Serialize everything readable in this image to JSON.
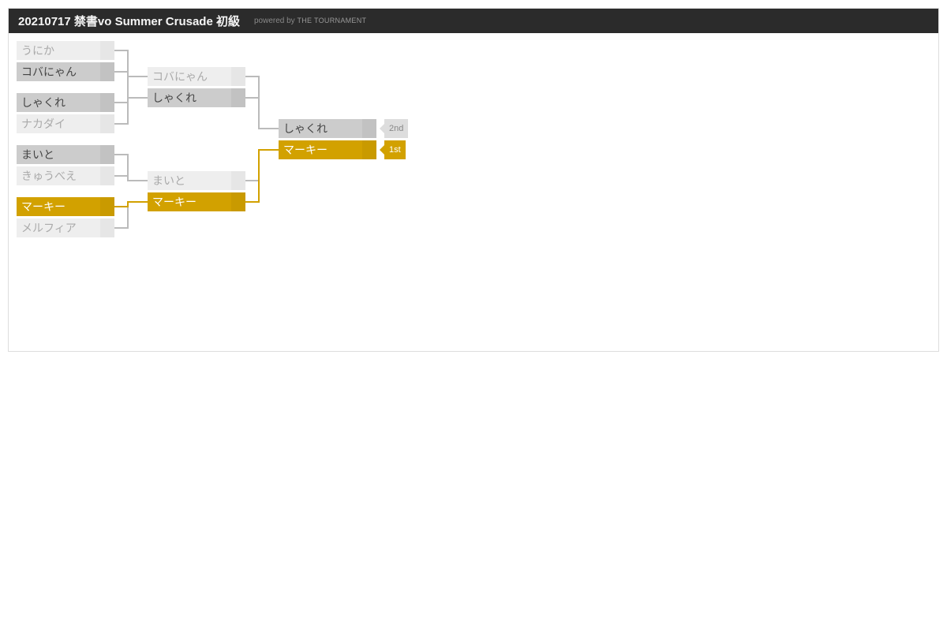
{
  "header": {
    "title": "20210717 禁書vo Summer Crusade 初級",
    "powered_by": "powered by",
    "brand": "THE TOURNAMENT"
  },
  "round1": [
    {
      "top": "うにか",
      "bot": "コバにゃん",
      "winner": "bot",
      "winstyle": "grey"
    },
    {
      "top": "しゃくれ",
      "bot": "ナカダイ",
      "winner": "top",
      "winstyle": "grey"
    },
    {
      "top": "まいと",
      "bot": "きゅうべえ",
      "winner": "top",
      "winstyle": "grey"
    },
    {
      "top": "マーキー",
      "bot": "メルフィア",
      "winner": "top",
      "winstyle": "gold"
    }
  ],
  "round2": [
    {
      "top": "コバにゃん",
      "bot": "しゃくれ",
      "winner": "bot",
      "winstyle": "grey"
    },
    {
      "top": "まいと",
      "bot": "マーキー",
      "winner": "bot",
      "winstyle": "gold"
    }
  ],
  "final": {
    "top": "しゃくれ",
    "bot": "マーキー",
    "winner": "bot",
    "winstyle": "gold"
  },
  "places": {
    "first": "1st",
    "second": "2nd"
  },
  "colors": {
    "gold": "#d2a100",
    "grey": "#cccccc",
    "light": "#eeeeee"
  }
}
